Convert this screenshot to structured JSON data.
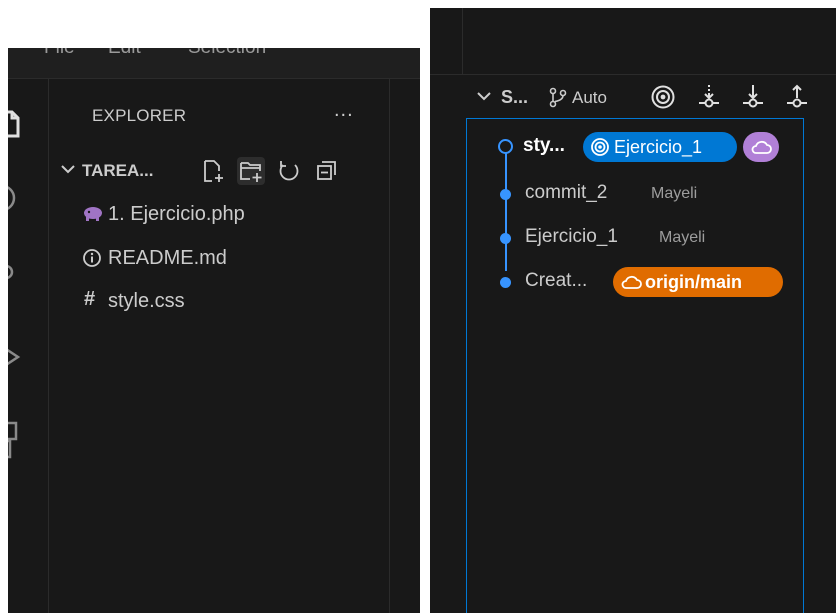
{
  "menubar": {
    "items": [
      "File",
      "Edit",
      "Selection"
    ]
  },
  "activity_bar": {
    "icons": [
      "files-icon",
      "search-icon",
      "source-control-icon",
      "run-debug-icon",
      "extensions-icon"
    ]
  },
  "explorer": {
    "title": "EXPLORER",
    "more_label": "...",
    "folder": {
      "name": "TAREA...",
      "expanded": true
    },
    "toolbar_icons": [
      "new-file-icon",
      "new-folder-icon",
      "refresh-icon",
      "collapse-all-icon"
    ],
    "files": [
      {
        "name": "1. Ejercicio.php",
        "icon": "php-elephant-icon",
        "icon_color": "#a074c4"
      },
      {
        "name": "README.md",
        "icon": "info-icon",
        "icon_color": "#42a5f5"
      },
      {
        "name": "style.css",
        "icon": "hash-icon",
        "icon_color": "#519aba"
      }
    ]
  },
  "source_control_graph": {
    "title": "S...",
    "branch_filter": "Auto",
    "header_icons": [
      "target-icon",
      "fetch-icon",
      "pull-icon",
      "push-icon"
    ],
    "commits": [
      {
        "message": "sty...",
        "author": "",
        "current": true,
        "badges": [
          {
            "label": "Ejercicio_1",
            "type": "local-branch",
            "color": "#0078d4"
          },
          {
            "label": "",
            "type": "remote",
            "color": "#b180d7"
          }
        ]
      },
      {
        "message": "commit_2",
        "author": "Mayeli",
        "current": false,
        "badges": []
      },
      {
        "message": "Ejercicio_1",
        "author": "Mayeli",
        "current": false,
        "badges": []
      },
      {
        "message": "Creat...",
        "author": "",
        "current": false,
        "badges": [
          {
            "label": "origin/main",
            "type": "remote-branch",
            "color": "#e06c00"
          }
        ]
      }
    ]
  },
  "colors": {
    "background": "#181818",
    "accent_blue": "#0078d4",
    "graph_blue": "#3794ff",
    "remote_orange": "#e06c00",
    "remote_purple": "#b180d7"
  }
}
